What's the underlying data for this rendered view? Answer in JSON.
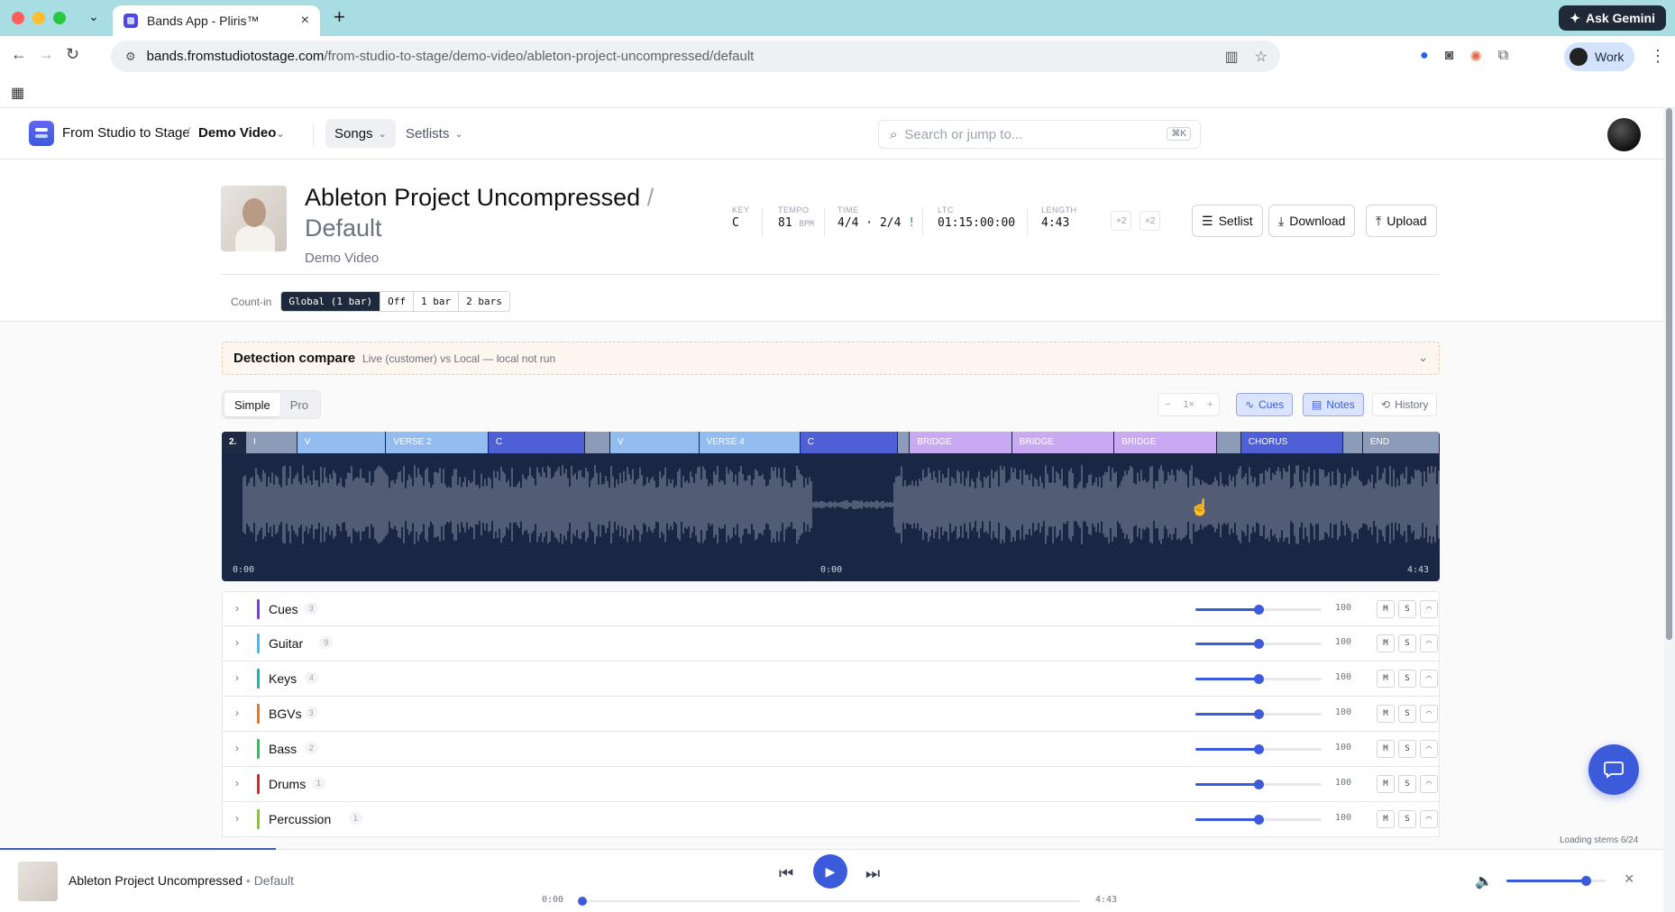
{
  "browser": {
    "tab_title": "Bands App - Pliris™",
    "url_host": "bands.fromstudiotostage.com",
    "url_path": "/from-studio-to-stage/demo-video/ableton-project-uncompressed/default",
    "ask_gemini": "Ask Gemini",
    "profile": "Work"
  },
  "nav": {
    "org": "From Studio to Stage",
    "project": "Demo Video",
    "songs": "Songs",
    "setlists": "Setlists",
    "search_placeholder": "Search or jump to...",
    "search_shortcut": "⌘K"
  },
  "song": {
    "title": "Ableton Project Uncompressed",
    "slash": "/",
    "version": "Default",
    "artist": "Demo Video",
    "meta": {
      "key_label": "KEY",
      "key": "C",
      "tempo_label": "TEMPO",
      "tempo": "81",
      "tempo_unit": "BPM",
      "time_label": "TIME",
      "time": "4/4 · 2/4",
      "time_warn": "!",
      "ltc_label": "LTC",
      "ltc": "01:15:00:00",
      "length_label": "LENGTH",
      "length": "4:43"
    },
    "transpose_up": "+2",
    "transpose_mult": "×2",
    "buttons": {
      "setlist": "Setlist",
      "download": "Download",
      "upload": "Upload"
    }
  },
  "countin": {
    "label": "Count-in",
    "options": [
      "Global (1 bar)",
      "Off",
      "1 bar",
      "2 bars"
    ],
    "active_index": 0
  },
  "detection": {
    "title": "Detection compare",
    "subtitle": "Live (customer) vs Local — local not run"
  },
  "view_mode": {
    "simple": "Simple",
    "pro": "Pro",
    "active": "Simple"
  },
  "waveform_controls": {
    "zoom_minus": "−",
    "zoom": "1×",
    "zoom_plus": "+",
    "cues": "Cues",
    "notes": "Notes",
    "history": "History"
  },
  "waveform": {
    "bar_marker": "2.",
    "sections": [
      {
        "label": "I",
        "start": 0.02,
        "end": 0.062,
        "color": "#8b9bb8"
      },
      {
        "label": "V",
        "start": 0.062,
        "end": 0.135,
        "color": "#93bdf0"
      },
      {
        "label": "VERSE 2",
        "start": 0.135,
        "end": 0.219,
        "color": "#93bdf0"
      },
      {
        "label": "C",
        "start": 0.219,
        "end": 0.298,
        "color": "#4f5fd6"
      },
      {
        "label": "",
        "start": 0.298,
        "end": 0.319,
        "color": "#8b9bb8"
      },
      {
        "label": "V",
        "start": 0.319,
        "end": 0.392,
        "color": "#93bdf0"
      },
      {
        "label": "VERSE 4",
        "start": 0.392,
        "end": 0.475,
        "color": "#93bdf0"
      },
      {
        "label": "C",
        "start": 0.475,
        "end": 0.555,
        "color": "#4f5fd6"
      },
      {
        "label": "",
        "start": 0.555,
        "end": 0.565,
        "color": "#8b9bb8"
      },
      {
        "label": "BRIDGE",
        "start": 0.565,
        "end": 0.649,
        "color": "#c9a9f2"
      },
      {
        "label": "BRIDGE",
        "start": 0.649,
        "end": 0.733,
        "color": "#c9a9f2"
      },
      {
        "label": "BRIDGE",
        "start": 0.733,
        "end": 0.817,
        "color": "#c9a9f2"
      },
      {
        "label": "",
        "start": 0.817,
        "end": 0.837,
        "color": "#8b9bb8"
      },
      {
        "label": "CHORUS",
        "start": 0.837,
        "end": 0.921,
        "color": "#4f5fd6"
      },
      {
        "label": "",
        "start": 0.921,
        "end": 0.937,
        "color": "#8b9bb8"
      },
      {
        "label": "END",
        "start": 0.937,
        "end": 1.0,
        "color": "#8b9bb8"
      }
    ],
    "time_start": "0:00",
    "time_mid": "0:00",
    "time_end": "4:43"
  },
  "tracks": [
    {
      "name": "Cues",
      "count": "3",
      "color": "#7c3aed",
      "volume": "100",
      "level": 0.5
    },
    {
      "name": "Guitar",
      "count": "9",
      "color": "#38bdf8",
      "volume": "100",
      "level": 0.5
    },
    {
      "name": "Keys",
      "count": "4",
      "color": "#14b8a6",
      "volume": "100",
      "level": 0.5
    },
    {
      "name": "BGVs",
      "count": "3",
      "color": "#f97316",
      "volume": "100",
      "level": 0.5
    },
    {
      "name": "Bass",
      "count": "2",
      "color": "#22c55e",
      "volume": "100",
      "level": 0.5
    },
    {
      "name": "Drums",
      "count": "1",
      "color": "#dc2626",
      "volume": "100",
      "level": 0.5
    },
    {
      "name": "Percussion",
      "count": "1",
      "color": "#84cc16",
      "volume": "100",
      "level": 0.5
    }
  ],
  "track_buttons": {
    "mute": "M",
    "solo": "S"
  },
  "loading": "Loading stems 6/24",
  "player": {
    "title": "Ableton Project Uncompressed",
    "dot": "•",
    "version": "Default",
    "time_start": "0:00",
    "time_end": "4:43",
    "progress": 0.0,
    "volume_level": 0.8
  },
  "colors": {
    "accent": "#3b5bdb",
    "waveform_bg": "#1a2744",
    "tabbar": "#a7dde3"
  }
}
